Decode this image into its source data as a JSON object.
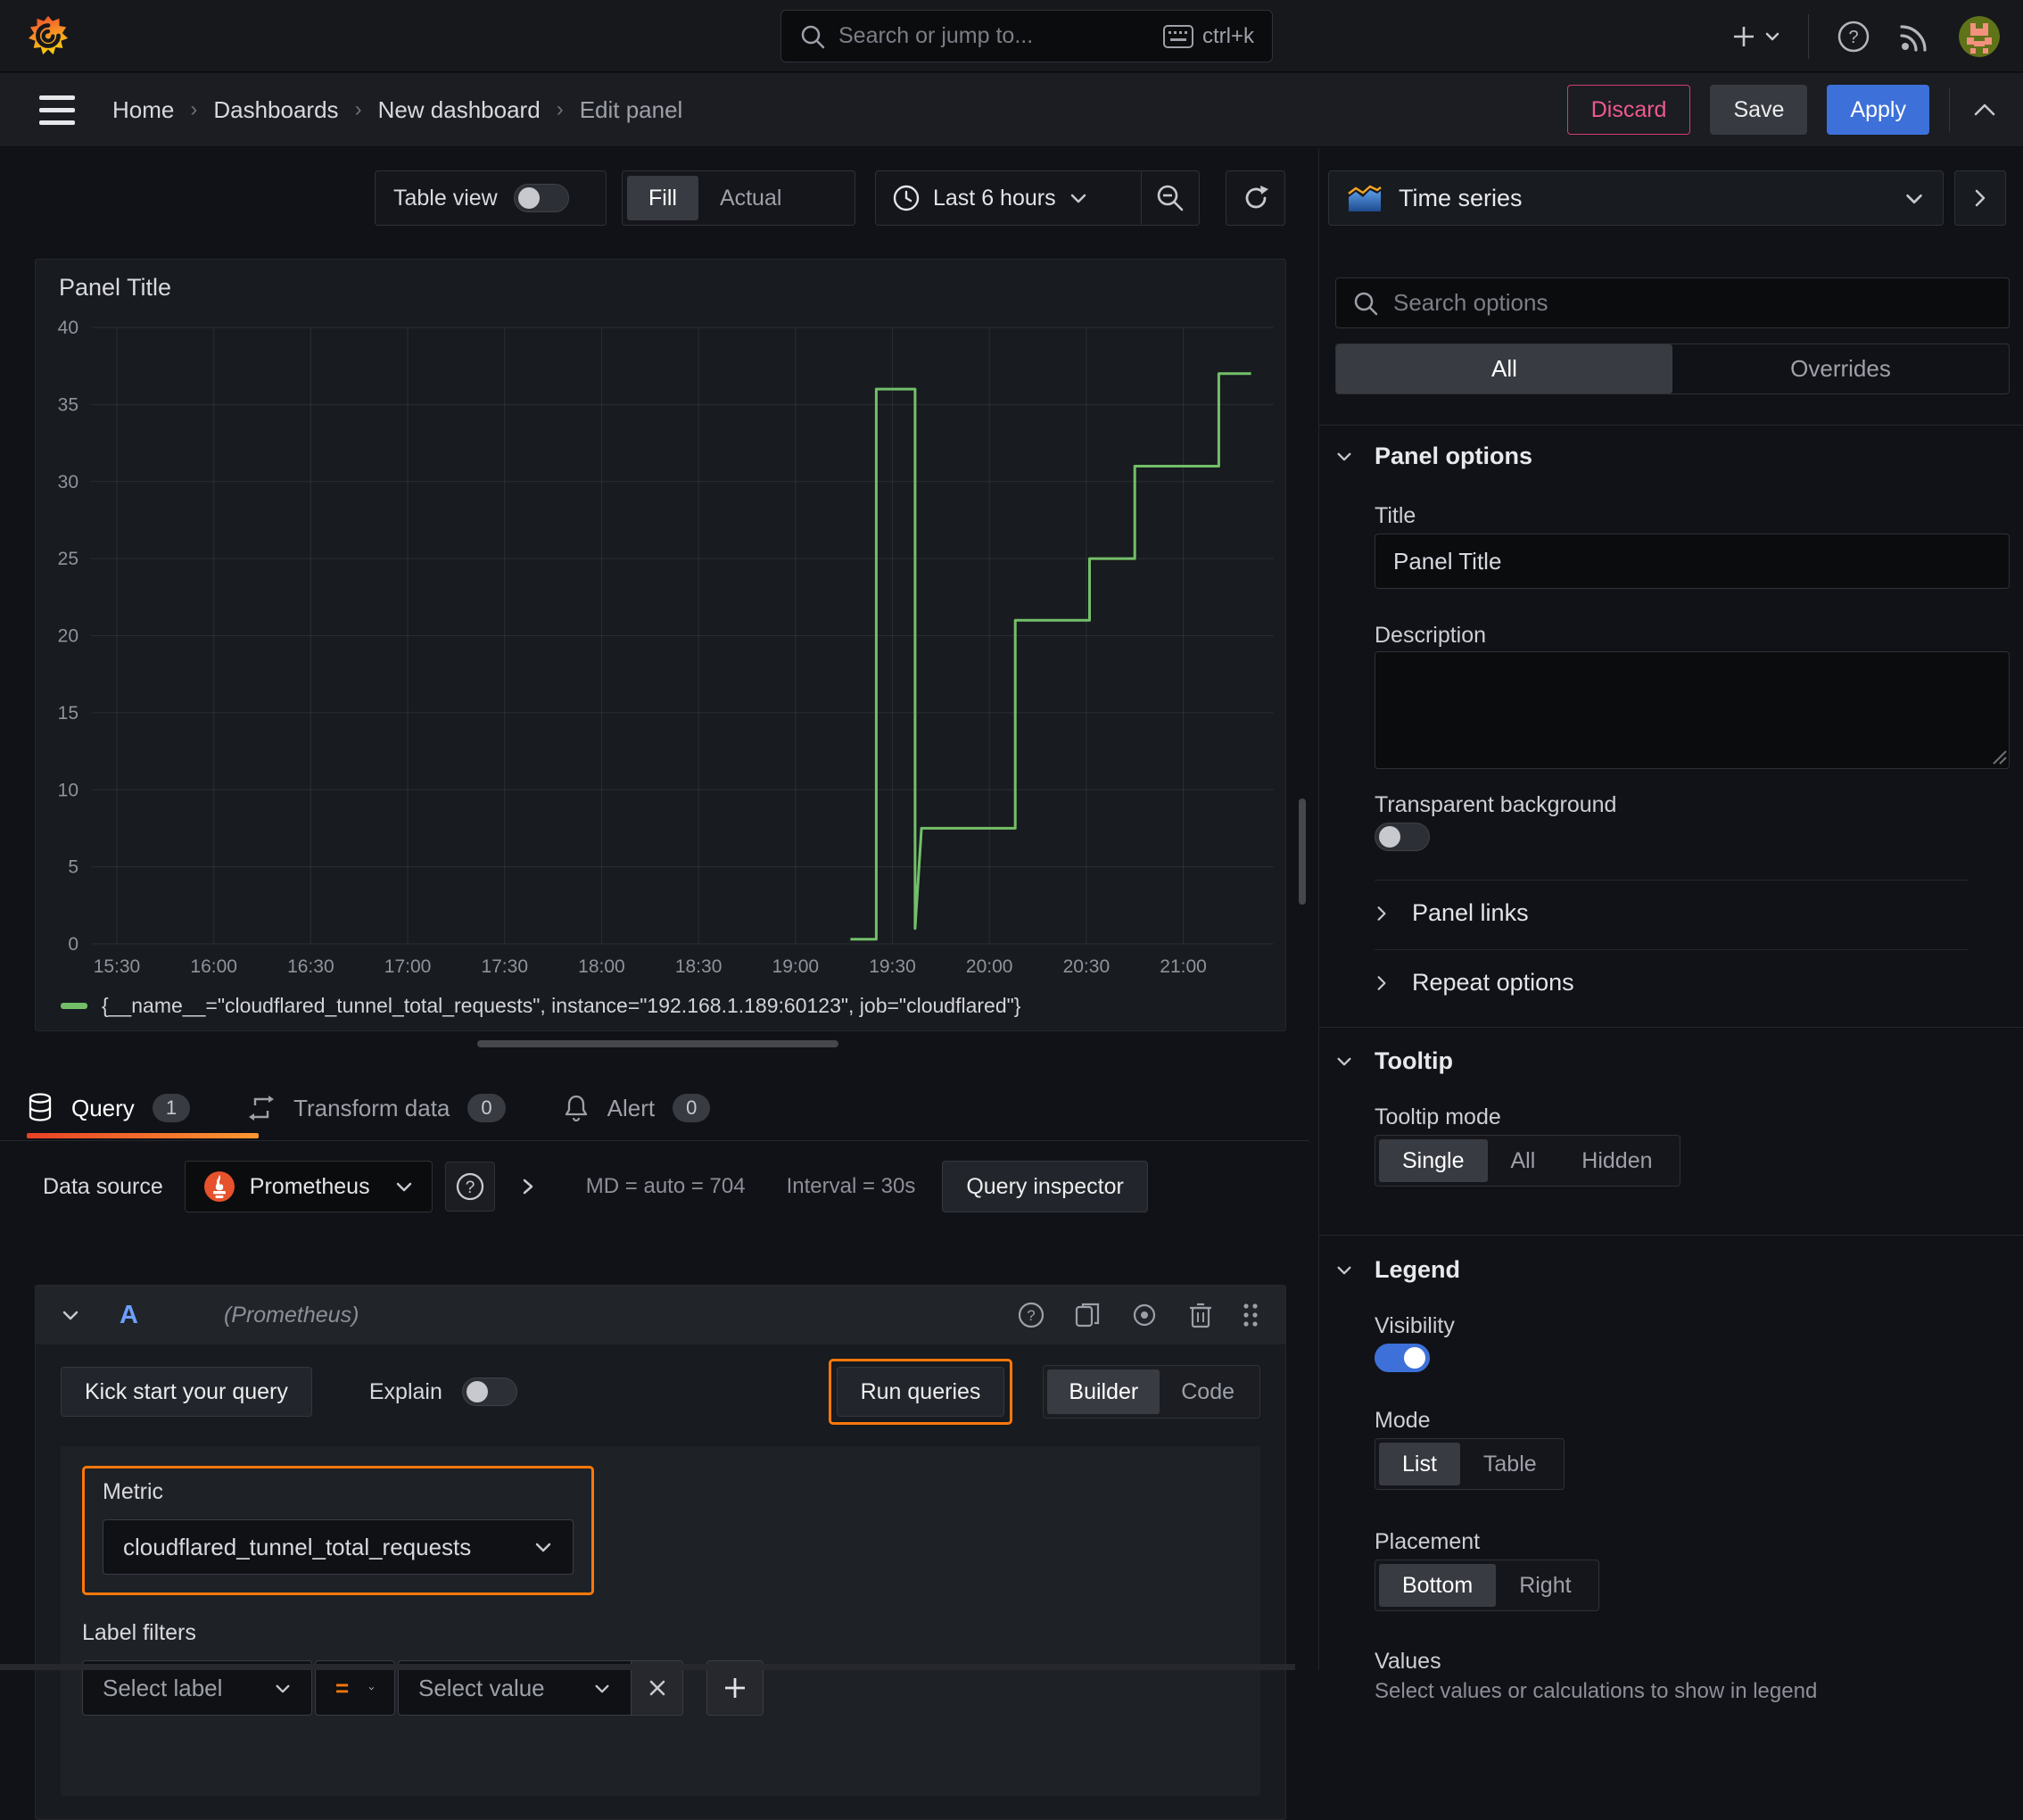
{
  "topbar": {
    "search_placeholder": "Search or jump to...",
    "shortcut_hint": "ctrl+k"
  },
  "breadcrumb": {
    "items": [
      "Home",
      "Dashboards",
      "New dashboard",
      "Edit panel"
    ]
  },
  "actions": {
    "discard": "Discard",
    "save": "Save",
    "apply": "Apply"
  },
  "toolbar": {
    "table_view_label": "Table view",
    "fill_label": "Fill",
    "actual_label": "Actual",
    "time_range_label": "Last 6 hours"
  },
  "viz_picker": {
    "selected": "Time series"
  },
  "options_pane": {
    "search_placeholder": "Search options",
    "filter_tabs": {
      "all": "All",
      "overrides": "Overrides"
    },
    "panel_options": {
      "header": "Panel options",
      "title_label": "Title",
      "title_value": "Panel Title",
      "description_label": "Description",
      "transparent_background_label": "Transparent background"
    },
    "panel_links_label": "Panel links",
    "repeat_options_label": "Repeat options",
    "tooltip": {
      "header": "Tooltip",
      "mode_label": "Tooltip mode",
      "modes": [
        "Single",
        "All",
        "Hidden"
      ],
      "selected_mode": "Single"
    },
    "legend": {
      "header": "Legend",
      "visibility_label": "Visibility",
      "mode_label": "Mode",
      "modes": [
        "List",
        "Table"
      ],
      "selected_mode": "List",
      "placement_label": "Placement",
      "placements": [
        "Bottom",
        "Right"
      ],
      "selected_placement": "Bottom",
      "values_label": "Values",
      "values_hint": "Select values or calculations to show in legend"
    }
  },
  "query_pane": {
    "tabs": [
      {
        "label": "Query",
        "count": "1"
      },
      {
        "label": "Transform data",
        "count": "0"
      },
      {
        "label": "Alert",
        "count": "0"
      }
    ],
    "datasource_label": "Data source",
    "datasource_name": "Prometheus",
    "max_data_points": "MD = auto = 704",
    "interval": "Interval = 30s",
    "query_inspector_label": "Query inspector",
    "row": {
      "ref_id": "A",
      "datasource_hint": "(Prometheus)"
    },
    "kick_start_label": "Kick start your query",
    "explain_label": "Explain",
    "run_queries_label": "Run queries",
    "builder_label": "Builder",
    "code_label": "Code",
    "metric_label": "Metric",
    "metric_value": "cloudflared_tunnel_total_requests",
    "label_filters_label": "Label filters",
    "select_label_placeholder": "Select label",
    "operator": "=",
    "select_value_placeholder": "Select value"
  },
  "chart_data": {
    "type": "line",
    "title": "Panel Title",
    "xlabel": "",
    "ylabel": "",
    "ylim": [
      0,
      40
    ],
    "y_ticks": [
      0,
      5,
      10,
      15,
      20,
      25,
      30,
      35,
      40
    ],
    "x_ticks": [
      "15:30",
      "16:00",
      "16:30",
      "17:00",
      "17:30",
      "18:00",
      "18:30",
      "19:00",
      "19:30",
      "20:00",
      "20:30",
      "21:00"
    ],
    "x_tick_minutes": [
      930,
      960,
      990,
      1020,
      1050,
      1080,
      1110,
      1140,
      1170,
      1200,
      1230,
      1260
    ],
    "x_range_minutes": [
      922,
      1288
    ],
    "grid": true,
    "legend_position": "bottom",
    "series": [
      {
        "name": "{__name__=\"cloudflared_tunnel_total_requests\", instance=\"192.168.1.189:60123\", job=\"cloudflared\"}",
        "color": "#73bf69",
        "points": [
          [
            1157,
            0.3
          ],
          [
            1165,
            0.3
          ],
          [
            1165,
            36
          ],
          [
            1177,
            36
          ],
          [
            1177,
            1
          ],
          [
            1179,
            7.5
          ],
          [
            1208,
            7.5
          ],
          [
            1208,
            21
          ],
          [
            1231,
            21
          ],
          [
            1231,
            25
          ],
          [
            1245,
            25
          ],
          [
            1245,
            31
          ],
          [
            1271,
            31
          ],
          [
            1271,
            37
          ],
          [
            1281,
            37
          ]
        ]
      }
    ]
  }
}
